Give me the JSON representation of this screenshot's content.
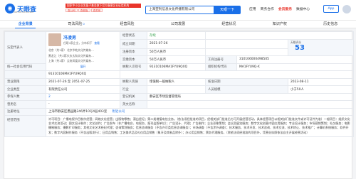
{
  "header": {
    "logo_text": "天眼查",
    "logo_sub": "TianYanCha.com",
    "tag_title": "国家中小企业发展子基金旗下官方备案企业征信机构",
    "tags": [
      "查公司",
      "查老板",
      "查关系"
    ],
    "search_value": "上海亚钊信息文化传播有限公司",
    "search_button": "天眼一下",
    "nav": [
      "应用",
      "商务合作",
      "会员服务",
      "数据中心"
    ],
    "app_button": "App"
  },
  "tabs": [
    {
      "label": "企业背景",
      "badge": ""
    },
    {
      "label": "司法风险",
      "badge": "0"
    },
    {
      "label": "经营风险",
      "badge": ""
    },
    {
      "label": "公司发展",
      "badge": ""
    },
    {
      "label": "经营状况",
      "badge": ""
    },
    {
      "label": "知识产权",
      "badge": ""
    },
    {
      "label": "历史信息",
      "badge": ""
    }
  ],
  "info": {
    "legal_label": "法定代表人",
    "legal_name": "冯凌男",
    "legal_sub": "任职4家企业，分布如下",
    "legal_link": "查看",
    "legal_list": [
      {
        "loc": "北京（共1家）",
        "co": "北京华乾文化传媒有..."
      },
      {
        "loc": "黑龙江（共1家）",
        "co": "大庆太和文化传媒有..."
      },
      {
        "loc": "上海（共1家）",
        "co": "云南凤凰文化传媒有..."
      }
    ],
    "legal_more": "展开",
    "status_label": "经营状态",
    "status_value": "存续",
    "found_label": "成立日期",
    "found_value": "2021-07-26",
    "reg_cap_label": "注册资本",
    "reg_cap_value": "50万人民币",
    "paid_cap_label": "实缴资本",
    "paid_cap_value": "50万人民币",
    "score_label": "天眼评分",
    "score_value": "53",
    "reg_no_label": "工商注册号",
    "reg_no_value": "310106000498505",
    "credit_label": "统一社会信用代码",
    "credit_value": "91310106MA1FYU9QXQ",
    "tax_label": "纳税人识别号",
    "tax_value": "91310106MA1FYU9QXQ",
    "org_label": "组织机构代码",
    "org_value": "MA1FYU9Q-X",
    "term_label": "营业期限",
    "term_value": "2021-07-26 至 2051-07-25",
    "taxpayer_label": "纳税人资质",
    "taxpayer_value": "增值税一般纳税人",
    "approve_label": "核准日期",
    "approve_value": "2023-08-11",
    "type_label": "企业类型",
    "type_value": "有限责任公司",
    "industry_label": "行业",
    "industry_value": "",
    "staff_label": "人员规模",
    "staff_value": "小于50人",
    "insured_label": "参保人数",
    "insured_value": "2",
    "authority_label": "登记机关",
    "authority_value": "静安区市场监督管理局",
    "former_label": "曾用名",
    "former_value": "-",
    "english_label": "英文名称",
    "english_value": "",
    "address_label": "注册地址",
    "address_value": "上海市静安区愚园路246弄10号4层403室",
    "address_link": "附近公司",
    "scope_label": "经营范围",
    "scope_value": "许可项目：广播电视节目制作经营；网络文化经营；出版物零售；演出经纪；第二类增值电信业务。（依法须经批准的项目，经相关部门批准后方可开展经营活动，具体经营项目以相关部门批准文件或许可证件为准）一般项目：组织文化艺术交流活动；图文设计制作；文艺创作；广告发布（非广播电台、电视台、报刊出版单位）；广告设计、代理；广告制作；企业形象策划；会议及展览服务；数字文化创意内容应用服务；专业设计服务；市场营销策划；礼仪服务；电影摄制服务；摄影扩印服务；其他文化艺术经纪代理；咨询策划服务；信息咨询服务（不含许可类信息咨询服务）；市场调查（不含涉外调查）；技术服务、技术开发、技术咨询、技术交流、技术转让、技术推广；计算机系统服务；软件开发；数字内容制作服务（不含出版发行）；日用品销售；工艺美术品及礼仪用品销售（象牙及其制品除外）；办公用品销售；票务代理服务。（除依法须经批准的项目外，凭营业执照依法自主开展经营活动）"
  }
}
